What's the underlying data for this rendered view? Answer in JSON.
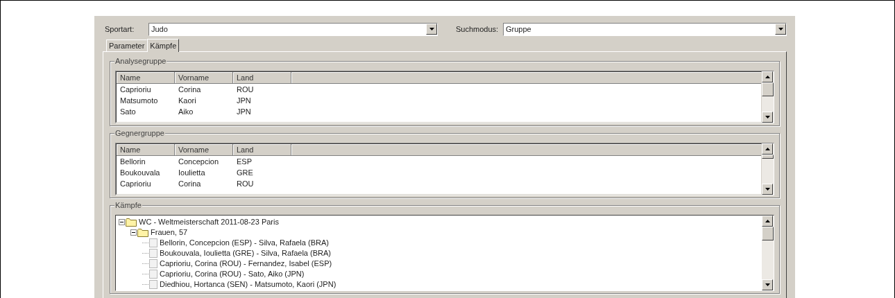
{
  "filters": [
    {
      "label": "Sportart:",
      "value": "Judo"
    },
    {
      "label": "Suchmodus:",
      "value": "Gruppe"
    }
  ],
  "tabs": [
    {
      "label": "Parameter",
      "selected": false
    },
    {
      "label": "Kämpfe",
      "selected": true
    }
  ],
  "groups": [
    {
      "title": "Analysegruppe",
      "columns": [
        "Name",
        "Vorname",
        "Land"
      ],
      "rows": [
        [
          "Caprioriu",
          "Corina",
          "ROU"
        ],
        [
          "Matsumoto",
          "Kaori",
          "JPN"
        ],
        [
          "Sato",
          "Aiko",
          "JPN"
        ]
      ]
    },
    {
      "title": "Gegnergruppe",
      "columns": [
        "Name",
        "Vorname",
        "Land"
      ],
      "rows": [
        [
          "Bellorin",
          "Concepcion",
          "ESP"
        ],
        [
          "Boukouvala",
          "Ioulietta",
          "GRE"
        ],
        [
          "Caprioriu",
          "Corina",
          "ROU"
        ]
      ]
    }
  ],
  "fights": {
    "title": "Kämpfe",
    "tree": [
      {
        "kind": "folder",
        "label": "WC - Weltmeisterschaft 2011-08-23 Paris",
        "expanded": true,
        "children": [
          {
            "kind": "folder",
            "label": "Frauen, 57",
            "expanded": true,
            "children": [
              {
                "kind": "item",
                "label": "Bellorin, Concepcion (ESP) - Silva, Rafaela (BRA)"
              },
              {
                "kind": "item",
                "label": "Boukouvala, Ioulietta (GRE) - Silva, Rafaela (BRA)"
              },
              {
                "kind": "item",
                "label": "Caprioriu, Corina (ROU) - Fernandez, Isabel (ESP)"
              },
              {
                "kind": "item",
                "label": "Caprioriu, Corina (ROU) - Sato, Aiko (JPN)"
              },
              {
                "kind": "item",
                "label": "Diedhiou, Hortanca (SEN) - Matsumoto, Kaori (JPN)"
              }
            ]
          }
        ]
      }
    ]
  }
}
